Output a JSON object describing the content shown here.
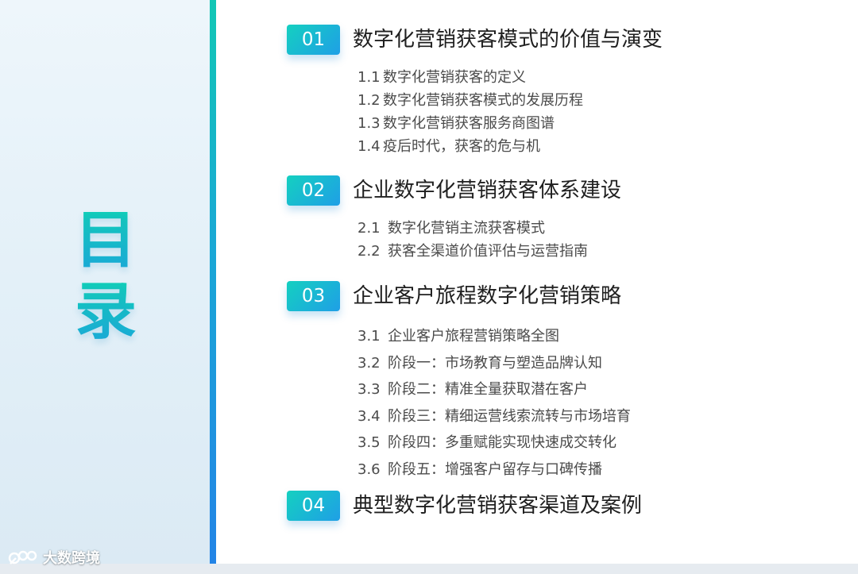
{
  "title": {
    "char1": "目",
    "char2": "录"
  },
  "watermark": {
    "text": "大数跨境"
  },
  "colors": {
    "accent_start": "#12c7b5",
    "accent_end": "#2384e6",
    "badge_text": "#ffffff",
    "heading_text": "#1f1f1f",
    "item_text": "#4b4b4b"
  },
  "sections": [
    {
      "number": "01",
      "title": "数字化营销获客模式的价值与演变",
      "items": [
        {
          "num": "1.1",
          "label": "数字化营销获客的定义"
        },
        {
          "num": "1.2",
          "label": "数字化营销获客模式的发展历程"
        },
        {
          "num": "1.3",
          "label": "数字化营销获客服务商图谱"
        },
        {
          "num": "1.4",
          "label": "疫后时代，获客的危与机"
        }
      ]
    },
    {
      "number": "02",
      "title": "企业数字化营销获客体系建设",
      "items": [
        {
          "num": "2.1",
          "label": "数字化营销主流获客模式"
        },
        {
          "num": "2.2",
          "label": "获客全渠道价值评估与运营指南"
        }
      ]
    },
    {
      "number": "03",
      "title": "企业客户旅程数字化营销策略",
      "items": [
        {
          "num": "3.1",
          "label": "企业客户旅程营销策略全图"
        },
        {
          "num": "3.2",
          "label": "阶段一：市场教育与塑造品牌认知"
        },
        {
          "num": "3.3",
          "label": "阶段二：精准全量获取潜在客户"
        },
        {
          "num": "3.4",
          "label": "阶段三：精细运营线索流转与市场培育"
        },
        {
          "num": "3.5",
          "label": "阶段四：多重赋能实现快速成交转化"
        },
        {
          "num": "3.6",
          "label": "阶段五：增强客户留存与口碑传播"
        }
      ]
    },
    {
      "number": "04",
      "title": "典型数字化营销获客渠道及案例"
    }
  ]
}
